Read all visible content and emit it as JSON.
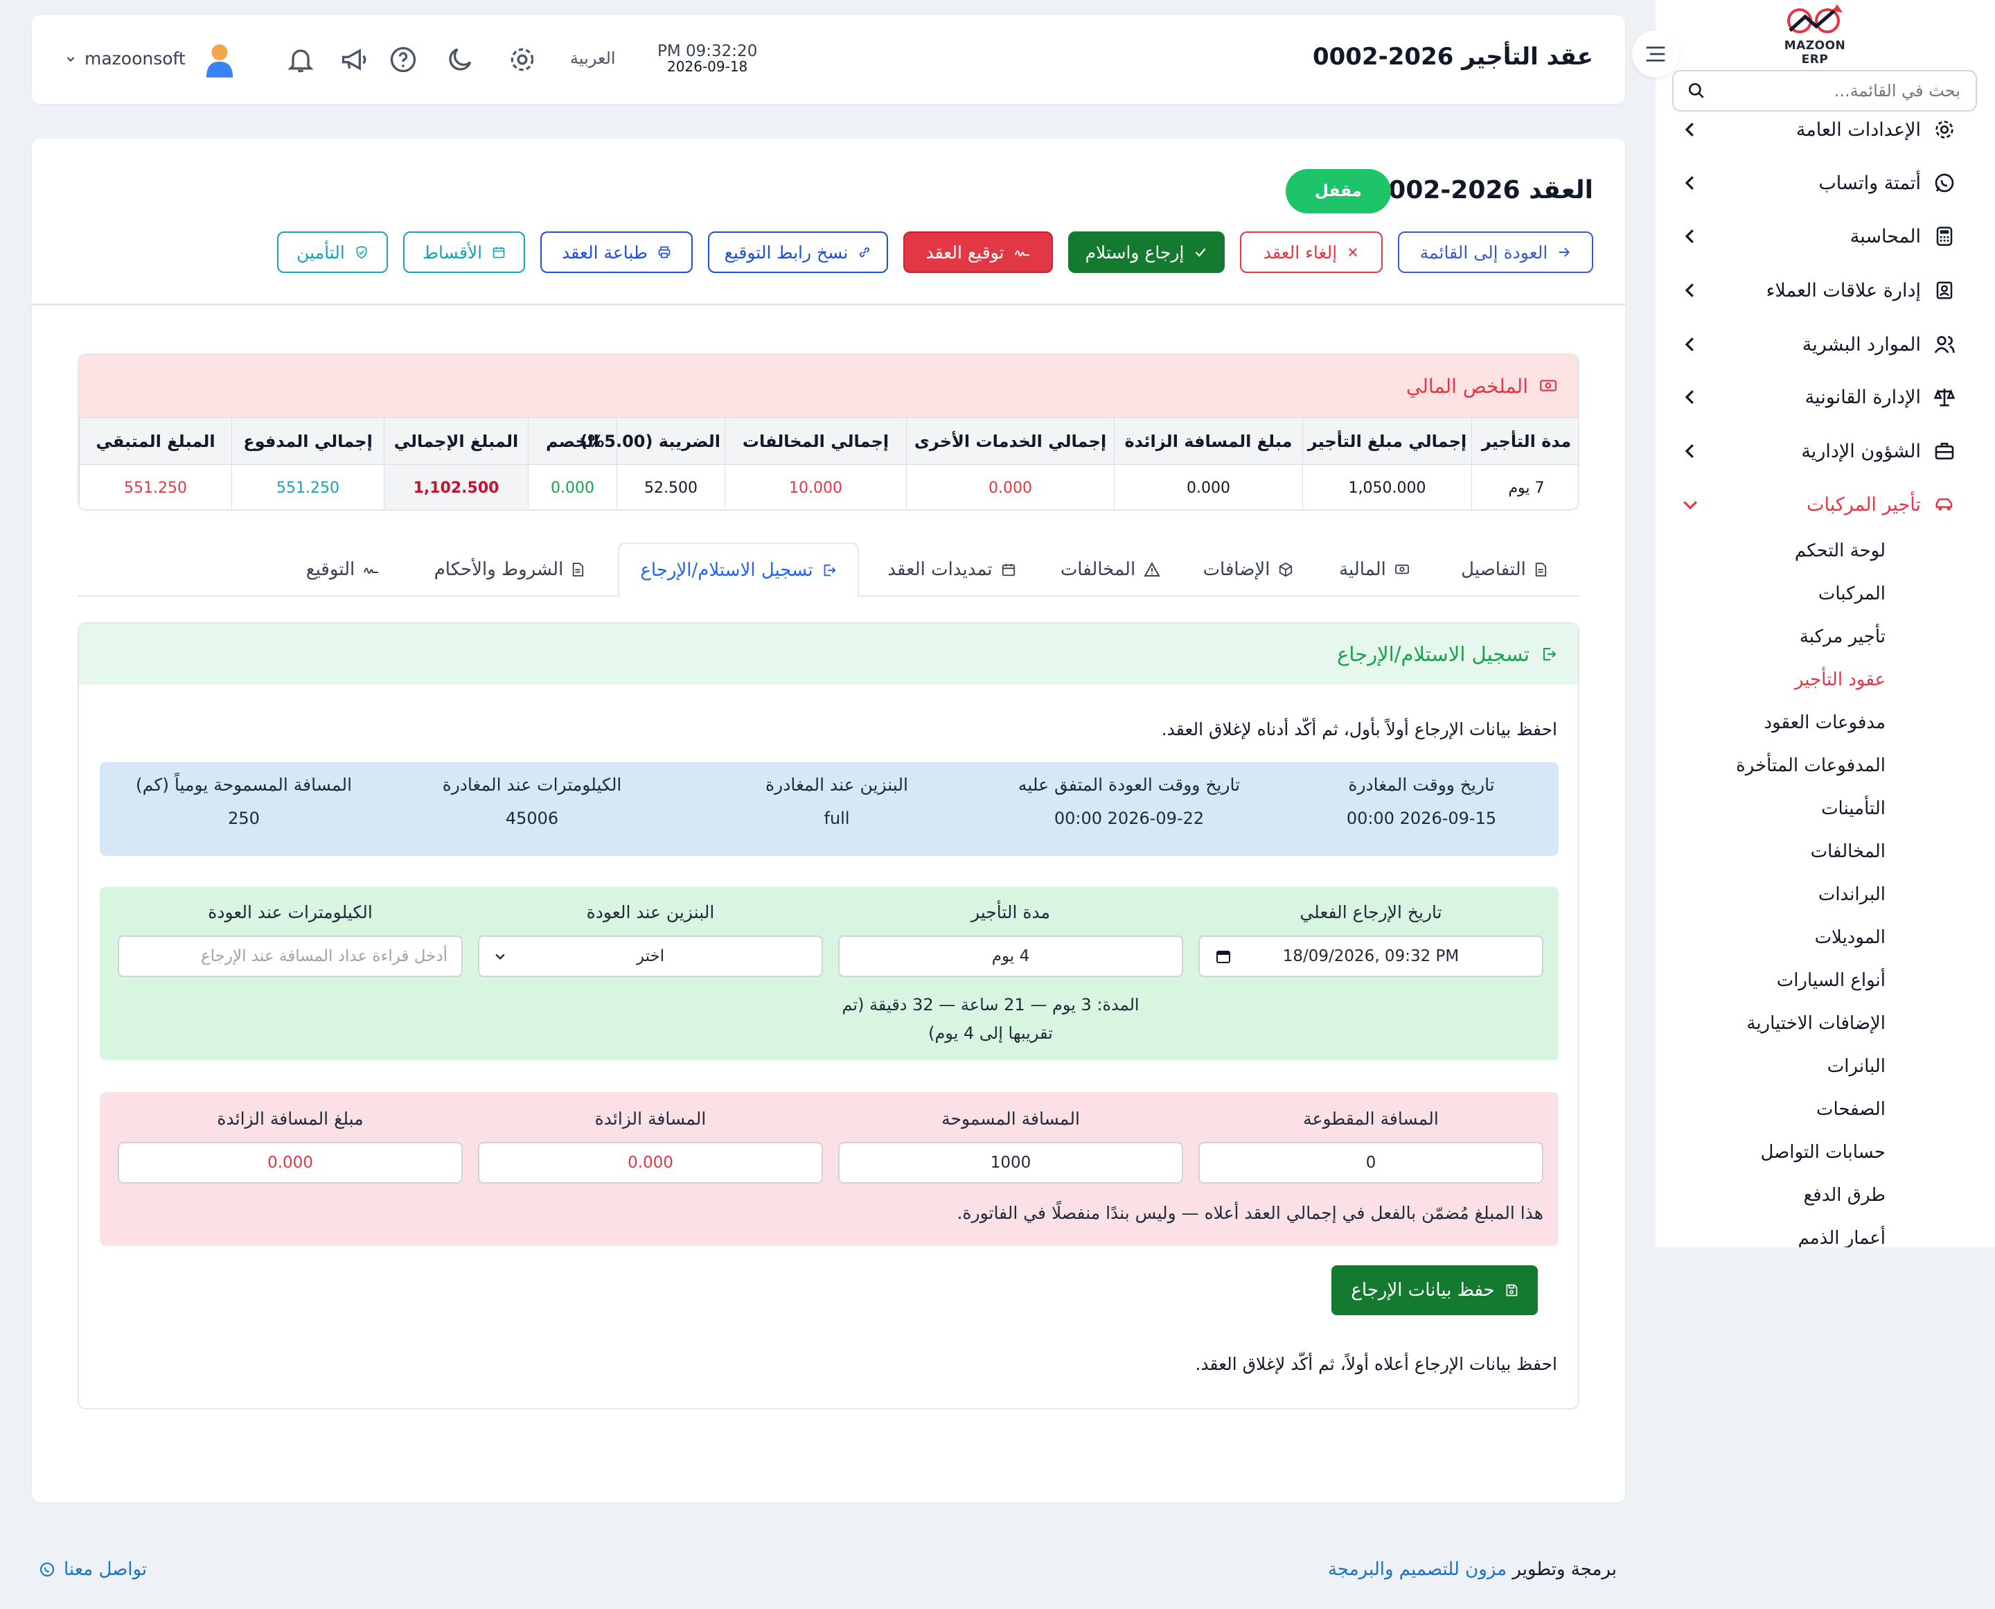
{
  "sidebar": {
    "brand": "MAZOON ERP",
    "brand_small": "ERP",
    "search_placeholder": "بحث في القائمة...",
    "items": [
      {
        "label": "الإعدادات العامة",
        "icon": "gear-icon"
      },
      {
        "label": "أتمتة واتساب",
        "icon": "whatsapp-icon"
      },
      {
        "label": "المحاسبة",
        "icon": "calculator-icon"
      },
      {
        "label": "إدارة علاقات العملاء",
        "icon": "contacts-icon"
      },
      {
        "label": "الموارد البشرية",
        "icon": "users-icon"
      },
      {
        "label": "الإدارة القانونية",
        "icon": "scale-icon"
      },
      {
        "label": "الشؤون الإدارية",
        "icon": "briefcase-icon"
      },
      {
        "label": "تأجير المركبات",
        "icon": "car-icon"
      }
    ],
    "sub_items": [
      "لوحة التحكم",
      "المركبات",
      "تأجير مركبة",
      "عقود التأجير",
      "مدفوعات العقود",
      "المدفوعات المتأخرة",
      "التأمينات",
      "المخالفات",
      "البراندات",
      "الموديلات",
      "أنواع السيارات",
      "الإضافات الاختيارية",
      "البانرات",
      "الصفحات",
      "حسابات التواصل",
      "طرق الدفع",
      "أعمار الذمم"
    ],
    "active_sub": "عقود التأجير"
  },
  "header": {
    "title": "عقد التأجير 2026-0002",
    "time": "PM 09:32:20",
    "date": "2026-09-18",
    "language": "العربية",
    "username": "mazoonsoft"
  },
  "contract": {
    "title": "العقد 2026-0002",
    "status": "مقفل",
    "actions": {
      "back": "العودة إلى القائمة",
      "cancel": "إلغاء العقد",
      "return": "إرجاع واستلام",
      "sign": "توقيع العقد",
      "copy_link": "نسخ رابط التوقيع",
      "print": "طباعة العقد",
      "installments": "الأقساط",
      "insurance": "التأمين"
    }
  },
  "summary": {
    "title": "الملخص المالي",
    "headers": [
      "مدة التأجير",
      "إجمالي مبلغ التأجير",
      "مبلغ المسافة الزائدة",
      "إجمالي الخدمات الأخرى",
      "إجمالي المخالفات",
      "الضريبة (5.00%)",
      "الخصم",
      "المبلغ الإجمالي",
      "إجمالي المدفوع",
      "المبلغ المتبقي"
    ],
    "values": [
      "7 يوم",
      "1,050.000",
      "0.000",
      "0.000",
      "10.000",
      "52.500",
      "0.000",
      "1,102.500",
      "551.250",
      "551.250"
    ]
  },
  "tabs": [
    "التفاصيل",
    "المالية",
    "الإضافات",
    "المخالفات",
    "تمديدات العقد",
    "تسجيل الاستلام/الإرجاع",
    "الشروط والأحكام",
    "التوقيع"
  ],
  "active_tab": "تسجيل الاستلام/الإرجاع",
  "return_panel": {
    "title": "تسجيل الاستلام/الإرجاع",
    "note": "احفظ بيانات الإرجاع أولاً بأول، ثم أكّد أدناه لإغلاق العقد.",
    "info": [
      {
        "label": "تاريخ ووقت المغادرة",
        "value": "2026-09-15 00:00"
      },
      {
        "label": "تاريخ ووقت العودة المتفق عليه",
        "value": "2026-09-22 00:00"
      },
      {
        "label": "البنزين عند المغادرة",
        "value": "full"
      },
      {
        "label": "الكيلومترات عند المغادرة",
        "value": "45006"
      },
      {
        "label": "المسافة المسموحة يومياً (كم)",
        "value": "250"
      }
    ],
    "actual_return_label": "تاريخ الإرجاع الفعلي",
    "actual_return_value": "18/09/2026, 09:32  PM",
    "duration_label": "مدة التأجير",
    "duration_value": "4 يوم",
    "duration_note_1": "المدة: 3 يوم — 21 ساعة — 32 دقيقة (تم",
    "duration_note_2": "تقريبها إلى 4 يوم)",
    "fuel_return_label": "البنزين عند العودة",
    "fuel_return_value": "اختر",
    "km_return_label": "الكيلومترات عند العودة",
    "km_return_placeholder": "أدخل قراءة عداد المسافة عند الإرجاع",
    "distance_driven_label": "المسافة المقطوعة",
    "distance_driven_value": "0",
    "allowed_distance_label": "المسافة المسموحة",
    "allowed_distance_value": "1000",
    "extra_distance_label": "المسافة الزائدة",
    "extra_distance_value": "0.000",
    "extra_amount_label": "مبلغ المسافة الزائدة",
    "extra_amount_value": "0.000",
    "pink_note": "هذا المبلغ مُضمّن بالفعل في إجمالي العقد أعلاه — وليس بندًا منفصلًا في الفاتورة.",
    "save_label": "حفظ بيانات الإرجاع",
    "footer_note": "احفظ بيانات الإرجاع أعلاه أولاً، ثم أكّد لإغلاق العقد."
  },
  "footer": {
    "contact": "تواصل معنا",
    "credit_prefix": "برمجة وتطوير",
    "credit_link": "مزون للتصميم والبرمجة"
  },
  "colors": {
    "accent_red": "#e23744",
    "accent_blue": "#2563eb",
    "success_green": "#16a34a",
    "save_green": "#137a2f",
    "teal": "#17a2b8"
  }
}
